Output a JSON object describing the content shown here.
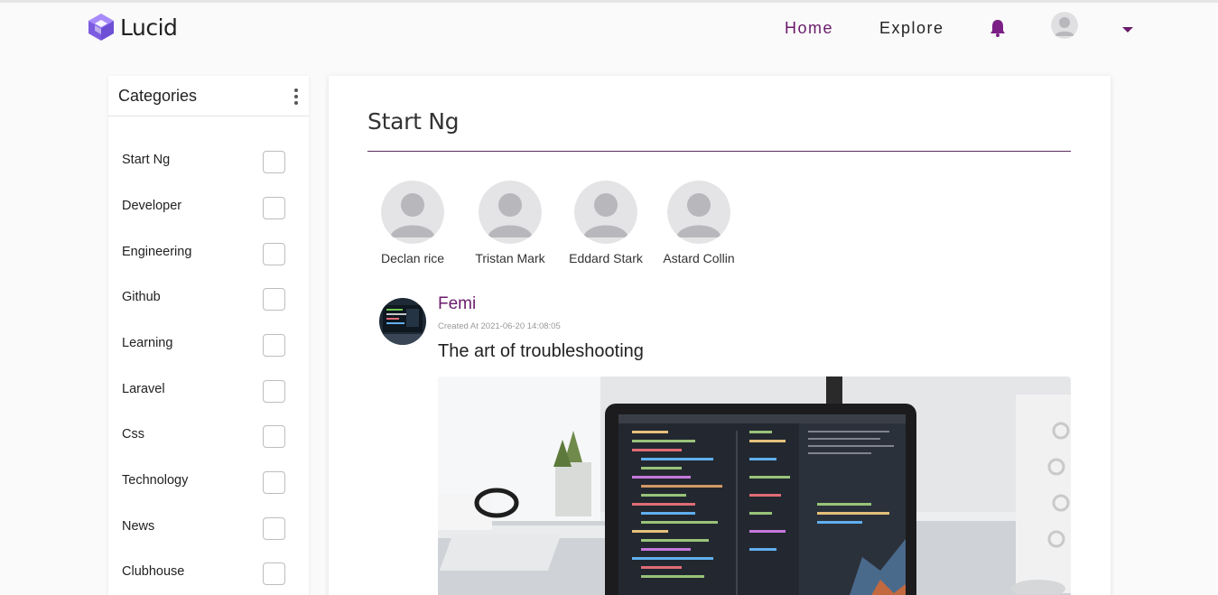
{
  "app": {
    "name": "Lucid"
  },
  "nav": {
    "home": "Home",
    "explore": "Explore"
  },
  "sidebar": {
    "title": "Categories",
    "items": [
      {
        "label": "Start Ng"
      },
      {
        "label": "Developer"
      },
      {
        "label": "Engineering"
      },
      {
        "label": "Github"
      },
      {
        "label": "Learning"
      },
      {
        "label": "Laravel"
      },
      {
        "label": "Css"
      },
      {
        "label": "Technology"
      },
      {
        "label": "News"
      },
      {
        "label": "Clubhouse"
      }
    ]
  },
  "main": {
    "title": "Start Ng",
    "members": [
      {
        "name": "Declan rice"
      },
      {
        "name": "Tristan Mark"
      },
      {
        "name": "Eddard Stark"
      },
      {
        "name": "Astard Collin"
      }
    ],
    "post": {
      "author": "Femi",
      "created": "Created At 2021-06-20 14:08:05",
      "title": "The art of troubleshooting"
    }
  },
  "colors": {
    "accent": "#6a1b6a",
    "logo": "#8b6fe0"
  },
  "icons": {
    "bell": "bell-icon",
    "caret": "caret-down-icon",
    "kebab": "kebab-menu-icon"
  }
}
